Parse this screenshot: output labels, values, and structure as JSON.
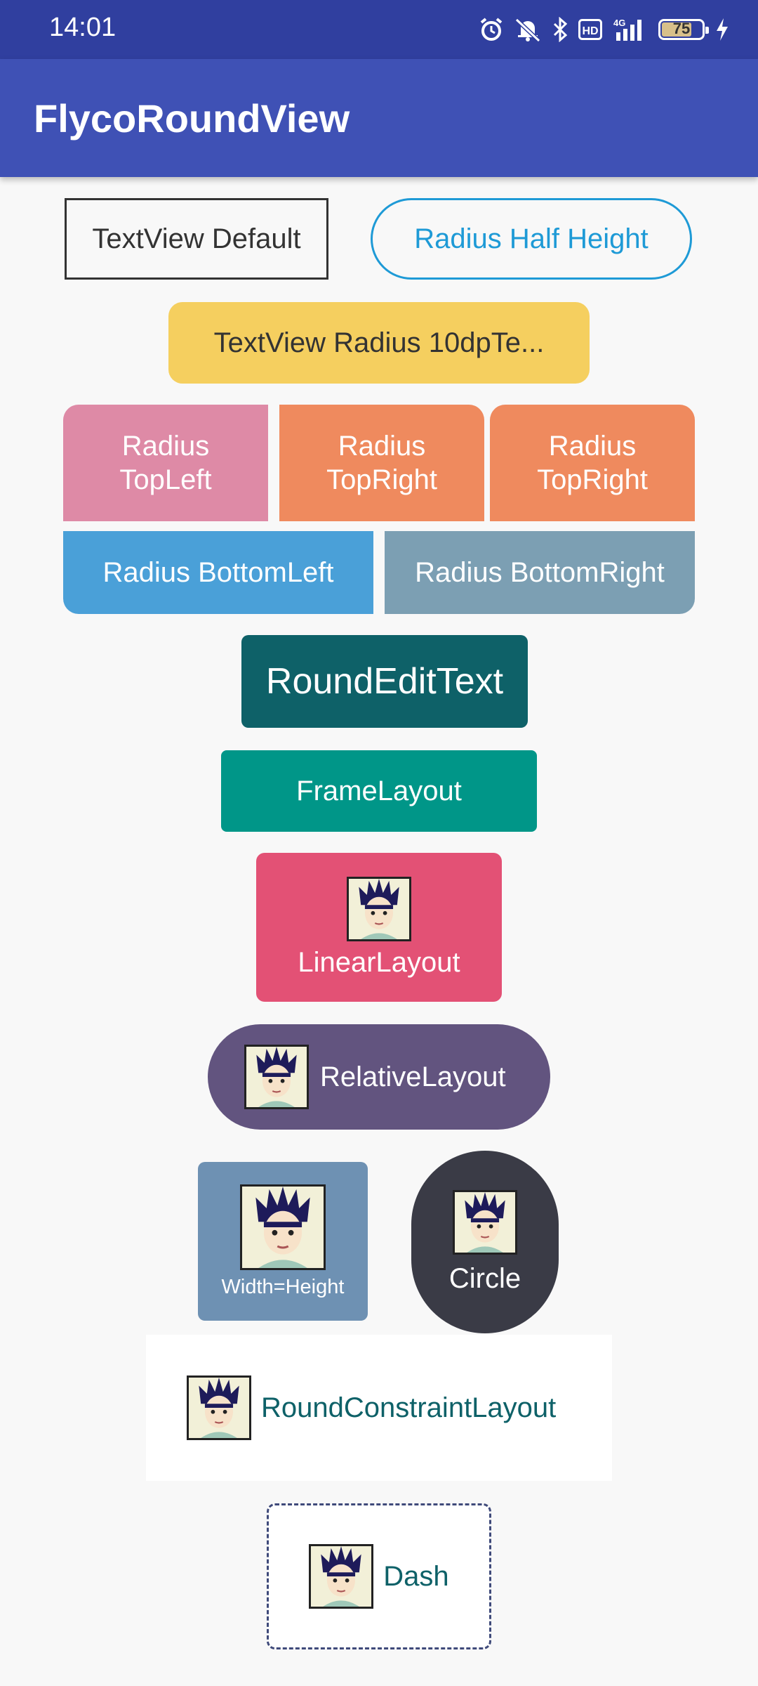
{
  "status": {
    "time": "14:01",
    "battery": "75"
  },
  "appbar": {
    "title": "FlycoRoundView"
  },
  "views": {
    "textview_default": "TextView Default",
    "radius_half_height": "Radius Half Height",
    "radius_10dp": "TextView Radius 10dpTe...",
    "radius_topleft": "Radius\nTopLeft",
    "radius_topright_1": "Radius\nTopRight",
    "radius_topright_2": "Radius\nTopRight",
    "radius_bottomleft": "Radius BottomLeft",
    "radius_bottomright": "Radius BottomRight",
    "round_edit_text": "RoundEditText",
    "frame_layout": "FrameLayout",
    "linear_layout": "LinearLayout",
    "relative_layout": "RelativeLayout",
    "width_height": "Width=Height",
    "circle": "Circle",
    "round_constraint_layout": "RoundConstraintLayout",
    "dash": "Dash"
  },
  "colors": {
    "status_bar": "#303f9f",
    "app_bar": "#3f51b5",
    "yellow": "#f5cf5f",
    "pink": "#de8aa6",
    "orange": "#ef8a5e",
    "blue": "#4aa0d8",
    "gray_blue": "#7c9fb3",
    "dark_teal": "#0e6168",
    "teal": "#009688",
    "red_pink": "#e35175",
    "purple": "#62547f",
    "steel_blue": "#6e91b3",
    "dark_circle": "#3a3b46",
    "accent_blue": "#1e9ad6"
  },
  "icons": [
    "alarm-icon",
    "mute-icon",
    "bluetooth-icon",
    "hd-icon",
    "signal-4g-icon",
    "battery-icon",
    "charging-icon",
    "avatar-icon"
  ]
}
